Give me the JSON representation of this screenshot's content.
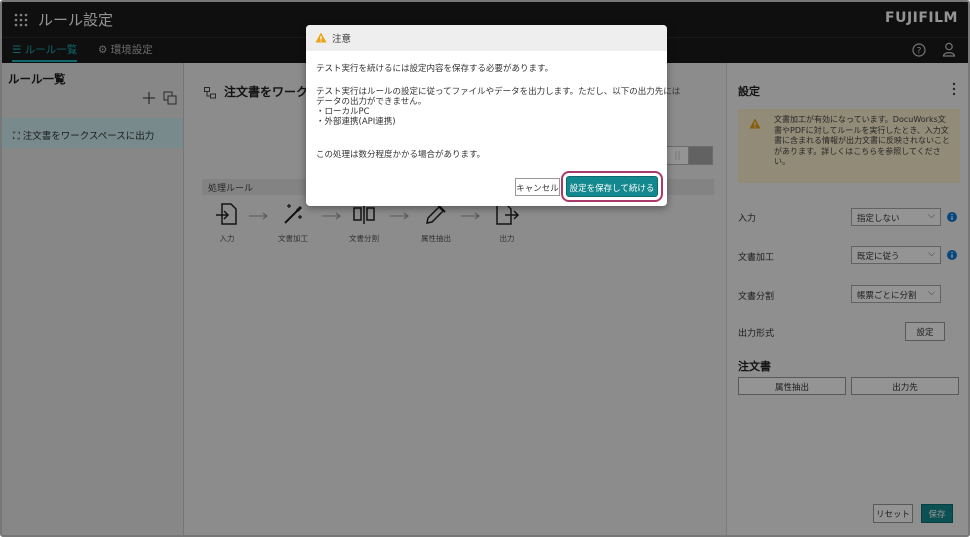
{
  "header": {
    "app_title": "ルール設定",
    "brand": "FUJIFILM",
    "tabs": [
      {
        "label": "ルール一覧",
        "icon": "list-icon",
        "active": true
      },
      {
        "label": "環境設定",
        "icon": "gear-icon",
        "active": false
      }
    ]
  },
  "sidebar": {
    "title": "ルール一覧",
    "items": [
      {
        "label": "注文書をワークスペースに出力",
        "selected": true
      }
    ]
  },
  "main": {
    "rule_title": "注文書をワークス",
    "processing_label": "処理ルール",
    "flow_steps": [
      {
        "label": "入力",
        "icon": "input-icon"
      },
      {
        "label": "文書加工",
        "icon": "magic-wand-icon"
      },
      {
        "label": "文書分割",
        "icon": "split-icon"
      },
      {
        "label": "属性抽出",
        "icon": "eyedropper-icon"
      },
      {
        "label": "出力",
        "icon": "output-icon"
      }
    ]
  },
  "settings_panel": {
    "title": "設定",
    "notice": "文書加工が有効になっています。DocuWorks文書やPDFに対してルールを実行したとき、入力文書に含まれる情報が出力文書に反映されないことがあります。詳しくはこちらを参照してください。",
    "fields": {
      "input": {
        "label": "入力",
        "value": "指定しない"
      },
      "processing": {
        "label": "文書加工",
        "value": "既定に従う"
      },
      "split": {
        "label": "文書分割",
        "value": "帳票ごとに分割"
      },
      "output_format": {
        "label": "出力形式",
        "button": "設定"
      }
    },
    "doc_section": "注文書",
    "attr_button": "属性抽出",
    "output_button": "出力先",
    "reset_button": "リセット",
    "save_button": "保存"
  },
  "dialog": {
    "title": "注意",
    "line1": "テスト実行を続けるには設定内容を保存する必要があります。",
    "body_lines": [
      "テスト実行はルールの設定に従ってファイルやデータを出力します。ただし、以下の出力先には",
      "データの出力ができません。",
      "・ローカルPC",
      "・外部連携(API連携)"
    ],
    "line3": "この処理は数分程度かかる場合があります。",
    "cancel": "キャンセル",
    "continue": "設定を保存して続ける"
  },
  "colors": {
    "accent": "#13898f",
    "highlight_ring": "#a8396d",
    "warning": "#e8a317",
    "info": "#0f7bd4"
  }
}
